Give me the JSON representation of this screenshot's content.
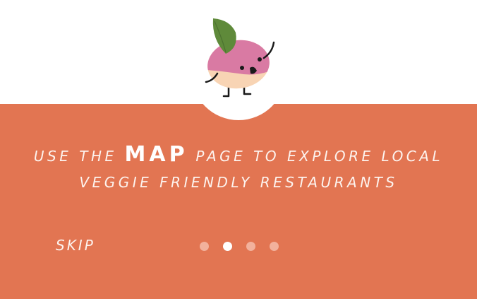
{
  "colors": {
    "panel": "#e27552",
    "text": "#fdf3ee",
    "dot_inactive": "#f2b19c",
    "dot_active": "#ffffff",
    "turnip_top": "#d97aa3",
    "turnip_bottom": "#f8d4b4",
    "leaf": "#5f8a3a"
  },
  "mascot": {
    "icon": "turnip-mascot-icon"
  },
  "headline": {
    "line1_before": "USE THE",
    "line1_emphasis": "MAP",
    "line1_after": "PAGE TO EXPLORE LOCAL",
    "line2": "VEGGIE FRIENDLY RESTAURANTS"
  },
  "controls": {
    "skip_label": "SKIP"
  },
  "pagination": {
    "total": 4,
    "current": 2
  }
}
